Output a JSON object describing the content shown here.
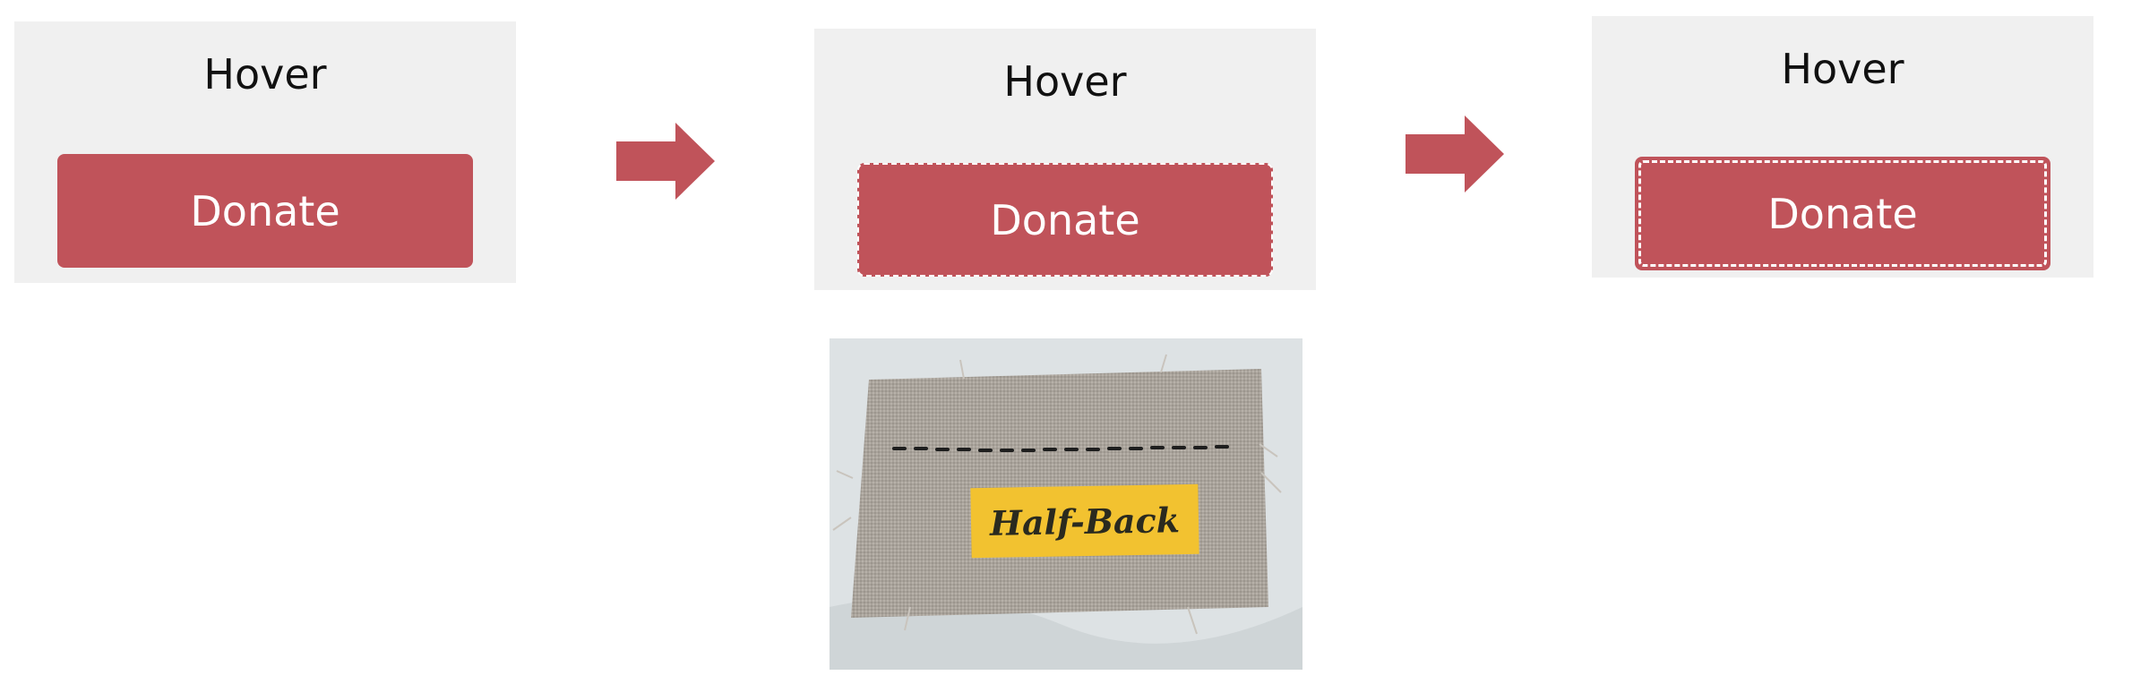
{
  "steps": [
    {
      "title": "Hover",
      "button_label": "Donate"
    },
    {
      "title": "Hover",
      "button_label": "Donate"
    },
    {
      "title": "Hover",
      "button_label": "Donate"
    }
  ],
  "photo": {
    "label": "Half-Back"
  },
  "colors": {
    "button": "#c0535a",
    "arrow": "#c0535a",
    "panel": "#f0f0f0",
    "photo_label": "#f2c230"
  },
  "icons": [
    "right-arrow-icon",
    "right-arrow-icon"
  ]
}
